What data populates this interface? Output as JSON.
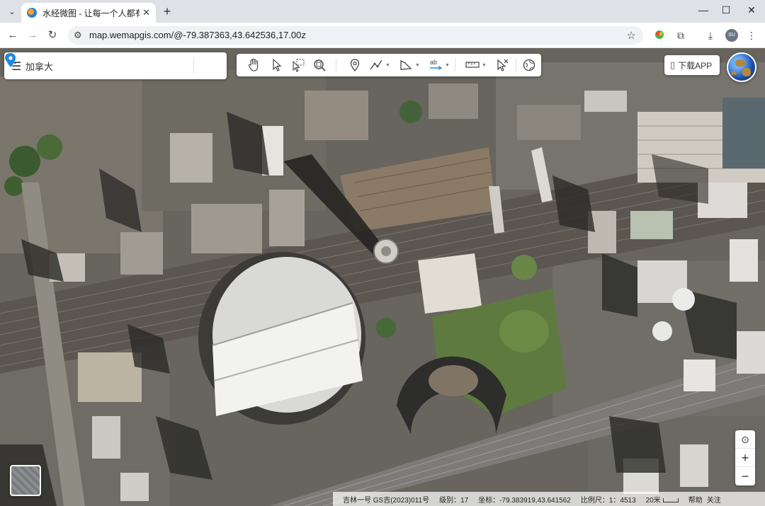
{
  "browser": {
    "tab_title": "水经微图 - 让每一个人都有自己",
    "tab_close": "✕",
    "new_tab": "+",
    "url": "map.wemapgis.com/@-79.387363,43.642536,17.00z",
    "profile_initials": "SU",
    "window_controls": [
      "—",
      "☐",
      "✕"
    ]
  },
  "search": {
    "value": "加拿大",
    "placeholder": "加拿大"
  },
  "toolbar_tools": [
    "pan-hand",
    "select-arrow",
    "select-box",
    "zoom-area",
    "point-marker",
    "polyline",
    "polygon",
    "text-label",
    "measure-ruler",
    "clear-cursor",
    "globe-3d"
  ],
  "app_download_label": "下载APP",
  "status": {
    "copyright": "吉林一号 GS吉(2023)011号",
    "level_label": "级别：",
    "level_value": "17",
    "coord_label": "坐标：",
    "coord_value": "-79.383919,43.641562",
    "scale_label": "比例尺：",
    "scale_value": "1：4513",
    "scale_bar": "20米",
    "help": "帮助",
    "follow": "关注"
  },
  "colors": {
    "accent_blue": "#1a73e8",
    "marker_blue": "#1e88e5"
  }
}
